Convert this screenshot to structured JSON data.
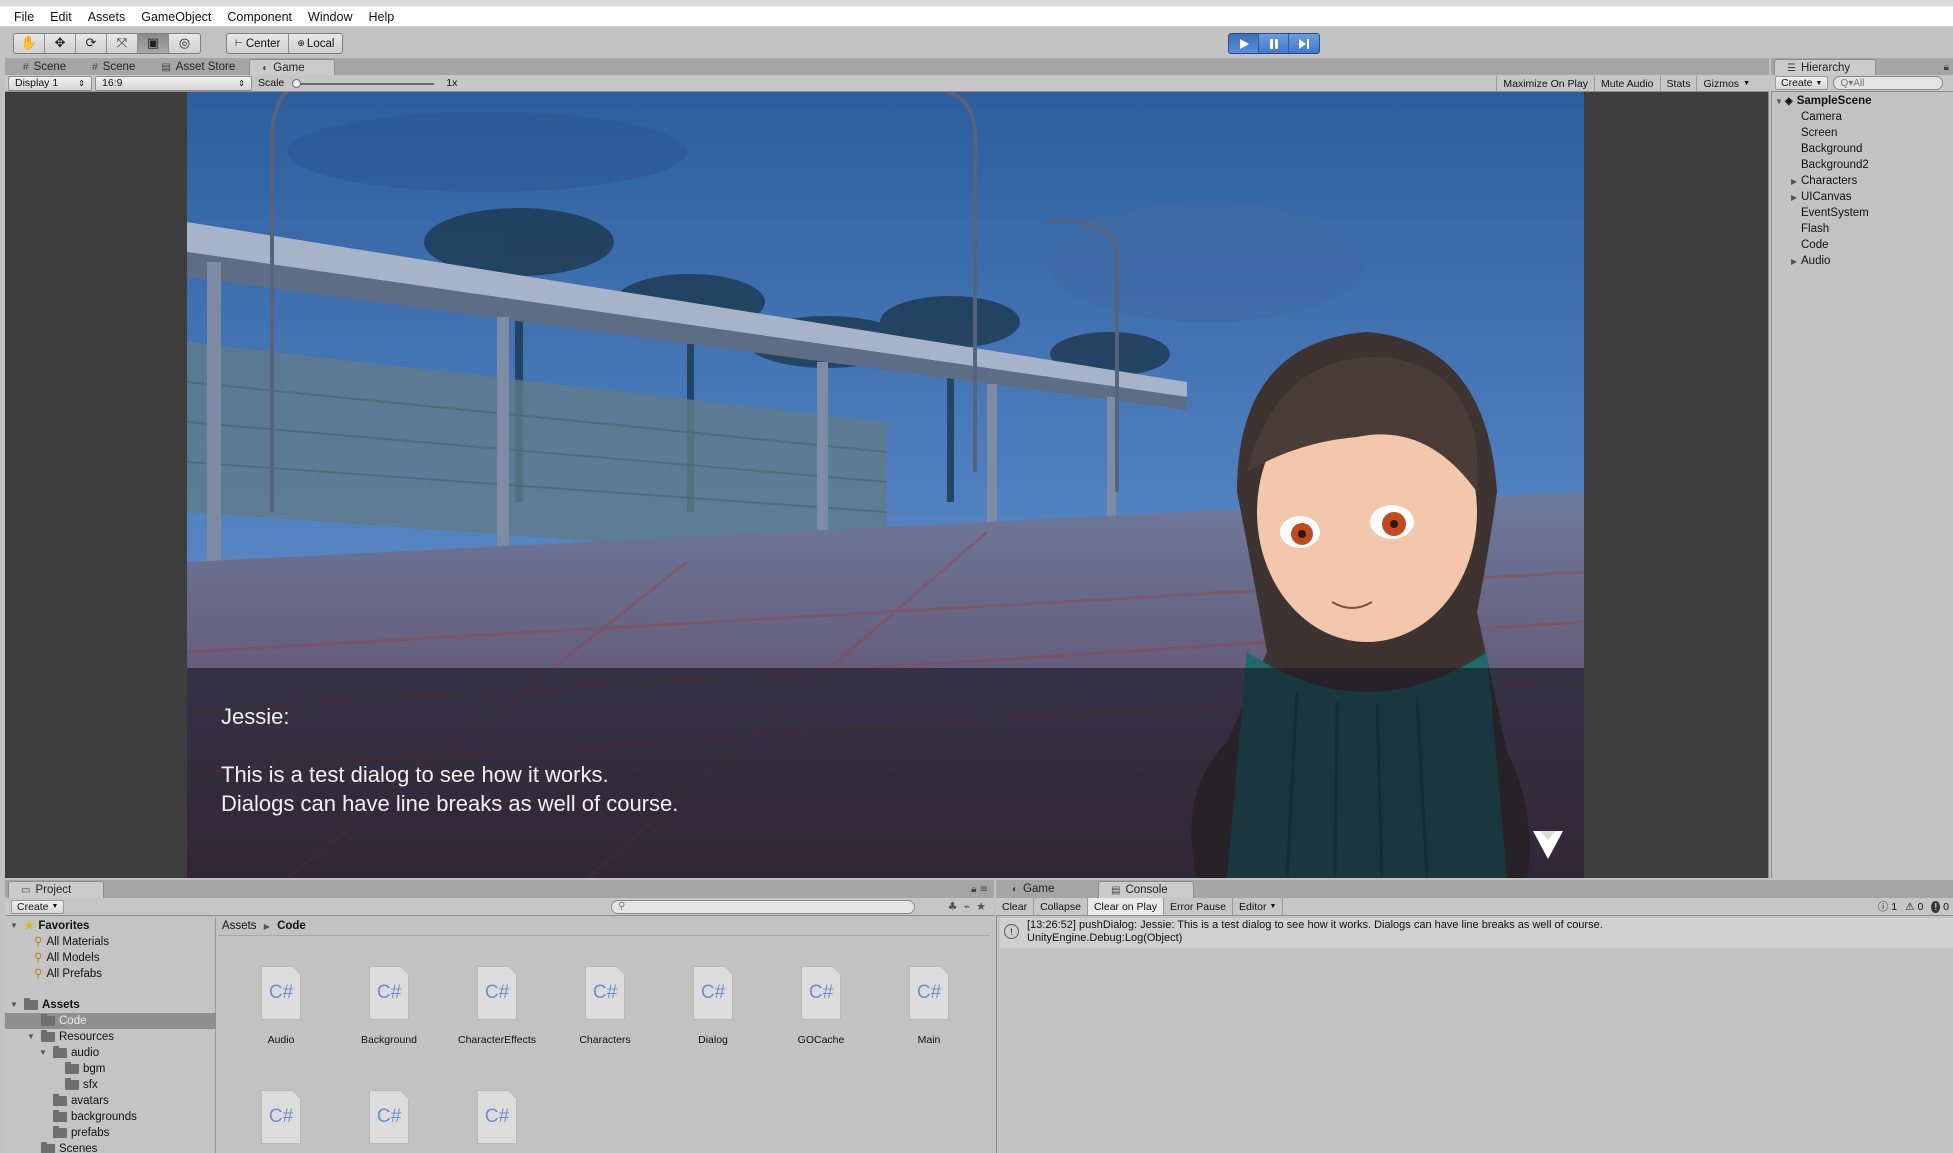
{
  "menu": [
    "File",
    "Edit",
    "Assets",
    "GameObject",
    "Component",
    "Window",
    "Help"
  ],
  "toolbar": {
    "transform_tools": [
      "hand-tool",
      "move-tool",
      "rotate-tool",
      "scale-tool",
      "rect-tool",
      "transform-tool"
    ],
    "pivot_label": "Center",
    "space_label": "Local"
  },
  "game_tabs": [
    "Scene",
    "Scene",
    "Asset Store",
    "Game"
  ],
  "game_bar": {
    "display": "Display 1",
    "aspect": "16:9",
    "scale_label": "Scale",
    "scale_value": "1x",
    "maximize": "Maximize On Play",
    "mute": "Mute Audio",
    "stats": "Stats",
    "gizmos": "Gizmos"
  },
  "dialog": {
    "speaker": "Jessie:",
    "line1": "This is a test dialog to see how it works.",
    "line2": "Dialogs can have line breaks as well of course."
  },
  "hierarchy": {
    "tab": "Hierarchy",
    "create": "Create",
    "search": "Q▾All",
    "scene": "SampleScene",
    "items": [
      {
        "label": "Camera",
        "expandable": false
      },
      {
        "label": "Screen",
        "expandable": false
      },
      {
        "label": "Background",
        "expandable": false
      },
      {
        "label": "Background2",
        "expandable": false
      },
      {
        "label": "Characters",
        "expandable": true
      },
      {
        "label": "UICanvas",
        "expandable": true
      },
      {
        "label": "EventSystem",
        "expandable": false
      },
      {
        "label": "Flash",
        "expandable": false
      },
      {
        "label": "Code",
        "expandable": false
      },
      {
        "label": "Audio",
        "expandable": true
      }
    ]
  },
  "project": {
    "tab": "Project",
    "create": "Create",
    "favorites_label": "Favorites",
    "favorites": [
      "All Materials",
      "All Models",
      "All Prefabs"
    ],
    "assets_label": "Assets",
    "tree": [
      "Code",
      "Resources",
      "audio",
      "bgm",
      "sfx",
      "avatars",
      "backgrounds",
      "prefabs",
      "Scenes"
    ],
    "breadcrumb_root": "Assets",
    "breadcrumb_current": "Code",
    "file_glyph": "C#",
    "files_row1": [
      "Audio",
      "Background",
      "CharacterEffects",
      "Characters",
      "Dialog",
      "GOCache",
      "Main"
    ],
    "files_row2_count": 3
  },
  "console": {
    "tabs": [
      "Game",
      "Console"
    ],
    "buttons": [
      "Clear",
      "Collapse",
      "Clear on Play",
      "Error Pause",
      "Editor"
    ],
    "info_count": "1",
    "warn_count": "0",
    "error_count": "0",
    "log_line1": "[13:26:52] pushDialog: Jessie:  This is a test dialog to see how it works. Dialogs can have line breaks as well of course.",
    "log_line2": "UnityEngine.Debug:Log(Object)"
  },
  "colors": {
    "play_accent": "#4a82d8",
    "editor_bg": "#c2c2c2",
    "night_sky": "#3c6aa5"
  }
}
